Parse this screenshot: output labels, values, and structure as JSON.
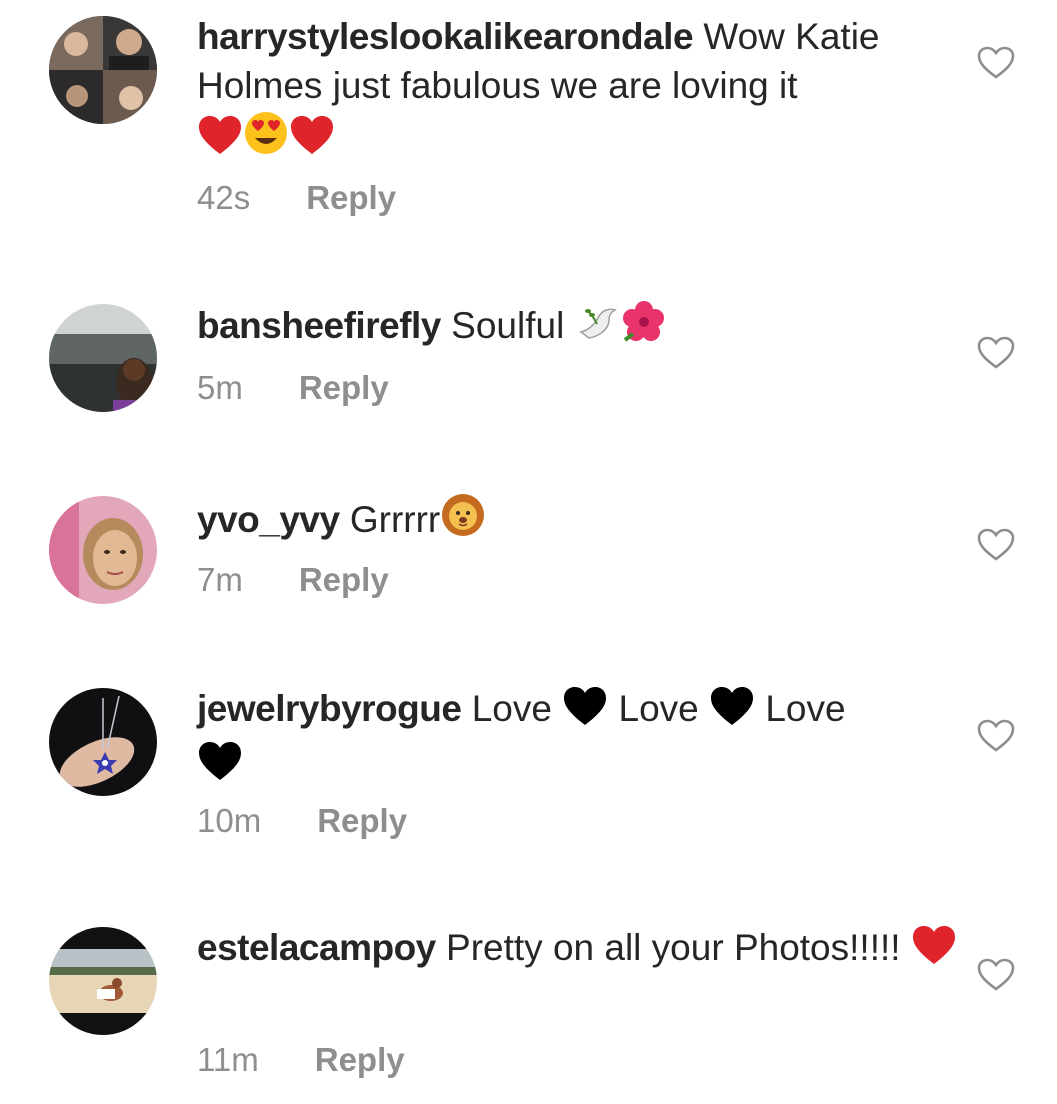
{
  "comments": [
    {
      "username": "harrystyleslookalikearondale",
      "text": "Wow Katie Holmes just fabulous we are loving it",
      "time": "42s",
      "reply_label": "Reply",
      "emojis": [
        "red-heart",
        "heart-eyes-face",
        "red-heart"
      ]
    },
    {
      "username": "bansheefirefly",
      "text": "Soulful",
      "time": "5m",
      "reply_label": "Reply",
      "emojis": [
        "dove",
        "hibiscus"
      ]
    },
    {
      "username": "yvo_yvy",
      "text": "Grrrrr",
      "time": "7m",
      "reply_label": "Reply",
      "emojis": [
        "lion-face"
      ]
    },
    {
      "username": "jewelrybyrogue",
      "text_parts": [
        "Love",
        "Love",
        "Love"
      ],
      "time": "10m",
      "reply_label": "Reply",
      "emojis": [
        "black-heart",
        "black-heart",
        "black-heart"
      ]
    },
    {
      "username": "estelacampoy",
      "text": "Pretty on all your Photos!!!!!",
      "time": "11m",
      "reply_label": "Reply",
      "emojis": [
        "red-heart"
      ]
    }
  ],
  "colors": {
    "text": "#262626",
    "secondary": "#8e8e8e",
    "like_outline": "#8e8e8e",
    "red_heart": "#e0242c",
    "black_heart": "#000000"
  }
}
